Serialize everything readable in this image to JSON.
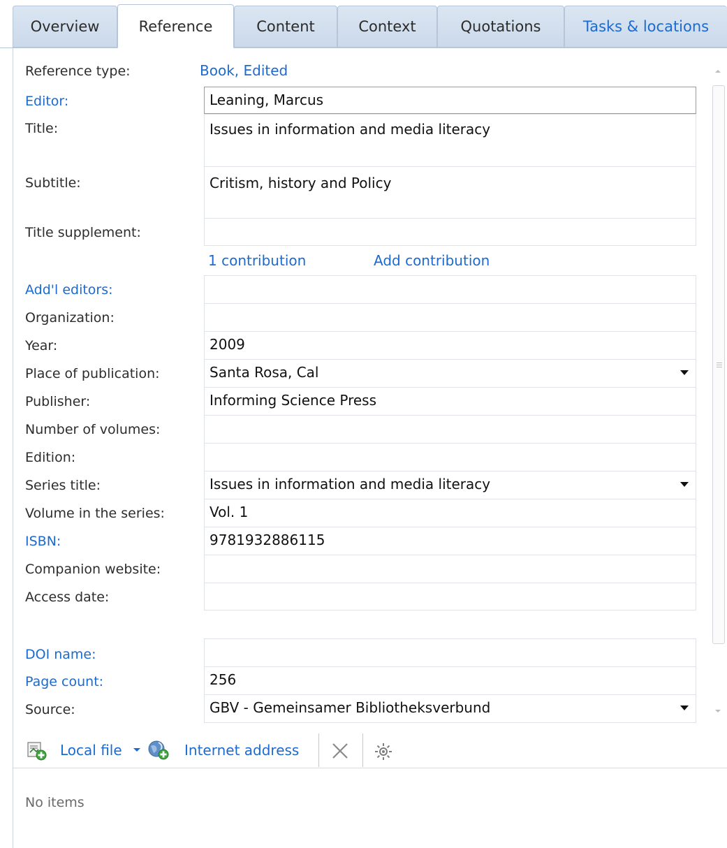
{
  "tabs": [
    {
      "label": "Overview"
    },
    {
      "label": "Reference"
    },
    {
      "label": "Content"
    },
    {
      "label": "Context"
    },
    {
      "label": "Quotations"
    },
    {
      "label": "Tasks & locations"
    }
  ],
  "form": {
    "reference_type_label": "Reference type:",
    "reference_type_value": "Book, Edited",
    "editor_label": "Editor:",
    "editor_value": "Leaning, Marcus",
    "title_label": "Title:",
    "title_value": "Issues in information and media literacy",
    "subtitle_label": "Subtitle:",
    "subtitle_value": "Critism, history and Policy",
    "title_supplement_label": "Title supplement:",
    "title_supplement_value": "",
    "contribution_count": "1 contribution",
    "add_contribution": "Add contribution",
    "addl_editors_label": "Add'l editors:",
    "addl_editors_value": "",
    "organization_label": "Organization:",
    "organization_value": "",
    "year_label": "Year:",
    "year_value": "2009",
    "place_label": "Place of publication:",
    "place_value": "Santa Rosa, Cal",
    "publisher_label": "Publisher:",
    "publisher_value": "Informing Science Press",
    "num_volumes_label": "Number of volumes:",
    "num_volumes_value": "",
    "edition_label": "Edition:",
    "edition_value": "",
    "series_title_label": "Series title:",
    "series_title_value": "Issues in information and media literacy",
    "volume_series_label": "Volume in the series:",
    "volume_series_value": "Vol. 1",
    "isbn_label": "ISBN:",
    "isbn_value": "9781932886115",
    "companion_label": "Companion website:",
    "companion_value": "",
    "access_date_label": "Access date:",
    "access_date_value": "",
    "doi_label": "DOI name:",
    "doi_value": "",
    "page_count_label": "Page count:",
    "page_count_value": "256",
    "source_label": "Source:",
    "source_value": "GBV - Gemeinsamer Bibliotheksverbund"
  },
  "attachments": {
    "local_file": "Local file",
    "internet_address": "Internet address",
    "empty_text": "No items"
  },
  "colors": {
    "link": "#1c6ad0",
    "tab_inactive": "#cbd9ea",
    "tab_border": "#b6c5d7"
  },
  "icons": [
    "local-file-add-icon",
    "dropdown-arrow-icon",
    "internet-address-add-icon",
    "delete-icon",
    "settings-gear-icon"
  ]
}
